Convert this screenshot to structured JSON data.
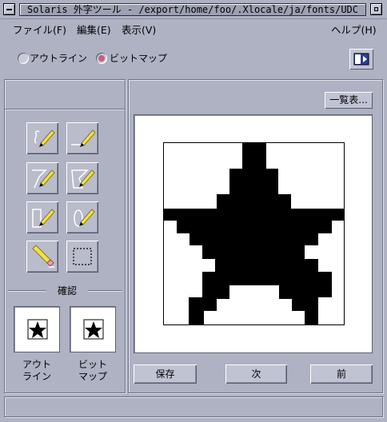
{
  "window": {
    "title": "Solaris 外字ツール - /export/home/foo/.Xlocale/ja/fonts/UDC"
  },
  "menubar": {
    "items": [
      {
        "label": "ファイル(F)"
      },
      {
        "label": "編集(E)"
      },
      {
        "label": "表示(V)"
      }
    ],
    "help": "ヘルプ(H)"
  },
  "mode": {
    "outline_label": "アウトライン",
    "bitmap_label": "ビットマップ",
    "selected": "bitmap"
  },
  "tools": [
    {
      "icon": "pencil-freehand-icon"
    },
    {
      "icon": "pencil-line-icon"
    },
    {
      "icon": "pencil-polyline-icon"
    },
    {
      "icon": "pencil-polygon-icon"
    },
    {
      "icon": "pencil-rectangle-icon"
    },
    {
      "icon": "pencil-ellipse-icon"
    },
    {
      "icon": "eraser-icon"
    },
    {
      "icon": "select-rectangle-icon"
    }
  ],
  "confirm": {
    "label": "確認",
    "outline_label_1": "アウト",
    "outline_label_2": "ライン",
    "bitmap_label_1": "ビット",
    "bitmap_label_2": "マップ"
  },
  "editor": {
    "list_button": "一覧表...",
    "glyph_icon": "star-glyph-icon",
    "buttons": {
      "save": "保存",
      "next": "次",
      "prev": "前"
    }
  },
  "colors": {
    "background": "#aeb2c3",
    "radio_selected": "#c8607f",
    "glyph": "#000000",
    "pencil_yellow": "#f2e24a"
  }
}
